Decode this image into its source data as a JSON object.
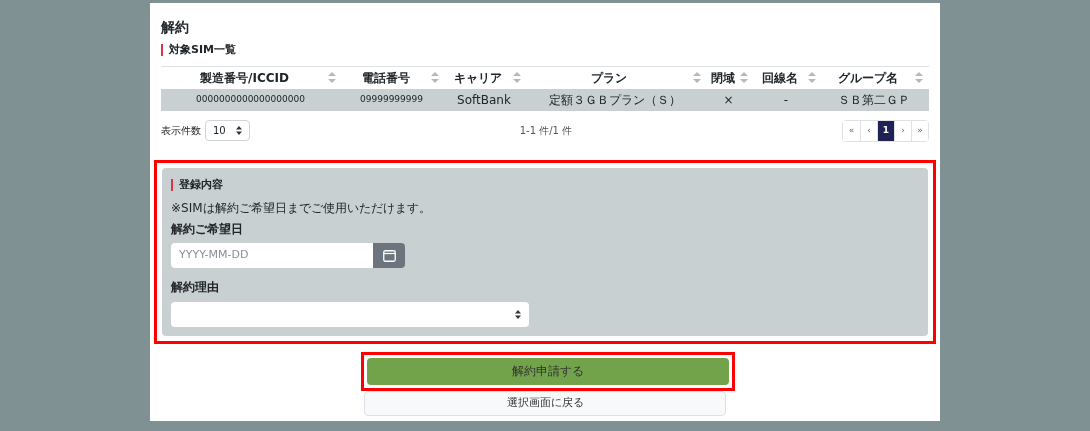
{
  "page_title": "解約",
  "sim_list": {
    "heading": "対象SIM一覧",
    "columns": [
      {
        "label": "製造番号/ICCID"
      },
      {
        "label": "電話番号"
      },
      {
        "label": "キャリア"
      },
      {
        "label": "プラン"
      },
      {
        "label": "閉域"
      },
      {
        "label": "回線名"
      },
      {
        "label": "グループ名"
      }
    ],
    "rows": [
      [
        "0000000000000000000",
        "09999999999",
        "SoftBank",
        "定額３ＧＢプラン（Ｓ）",
        "×",
        "-",
        "ＳＢ第二ＧＰ"
      ]
    ],
    "page_size_label": "表示件数",
    "page_size": "10",
    "count_text": "1-1 件/1 件",
    "pagination": [
      {
        "label": "«",
        "selected": false
      },
      {
        "label": "‹",
        "selected": false
      },
      {
        "label": "1",
        "selected": true
      },
      {
        "label": "›",
        "selected": false
      },
      {
        "label": "»",
        "selected": false
      }
    ]
  },
  "registration": {
    "highlighted": true,
    "heading": "登録内容",
    "note": "※SIMは解約ご希望日までご使用いただけます。",
    "date_label": "解約ご希望日",
    "date_placeholder": "YYYY-MM-DD",
    "reason_label": "解約理由"
  },
  "submit_button": {
    "label": "解約申請する",
    "highlighted": true
  },
  "back_button": {
    "label": "選択画面に戻る"
  }
}
